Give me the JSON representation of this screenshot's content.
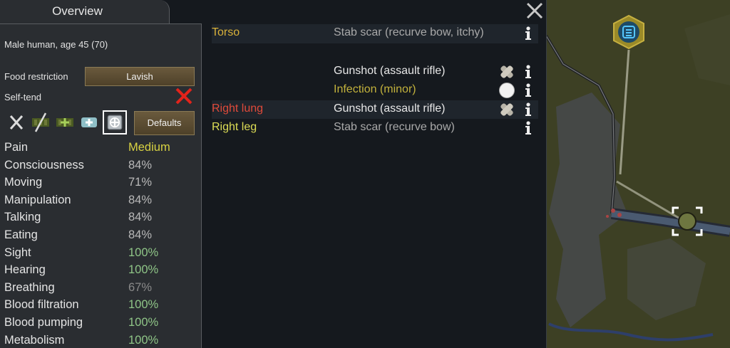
{
  "window": {
    "tab_label": "Overview",
    "close_icon": "close-icon"
  },
  "overview": {
    "pawn_description": "Male human, age 45 (70)",
    "food_restriction_label": "Food restriction",
    "food_restriction_value": "Lavish",
    "self_tend_label": "Self-tend",
    "self_tend_state": "off",
    "medical_care_options": [
      "no-care",
      "no-meds",
      "herbal",
      "industrial",
      "glitterworld"
    ],
    "medical_care_selected": "glitterworld",
    "defaults_label": "Defaults",
    "capacities": [
      {
        "name": "Pain",
        "value": "Medium",
        "color": "#d8d242"
      },
      {
        "name": "Consciousness",
        "value": "84%",
        "color": "#b9b9b9"
      },
      {
        "name": "Moving",
        "value": "71%",
        "color": "#b9b9b9"
      },
      {
        "name": "Manipulation",
        "value": "84%",
        "color": "#b9b9b9"
      },
      {
        "name": "Talking",
        "value": "84%",
        "color": "#b9b9b9"
      },
      {
        "name": "Eating",
        "value": "84%",
        "color": "#b9b9b9"
      },
      {
        "name": "Sight",
        "value": "100%",
        "color": "#8fc587"
      },
      {
        "name": "Hearing",
        "value": "100%",
        "color": "#8fc587"
      },
      {
        "name": "Breathing",
        "value": "67%",
        "color": "#8a8a8a"
      },
      {
        "name": "Blood filtration",
        "value": "100%",
        "color": "#8fc587"
      },
      {
        "name": "Blood pumping",
        "value": "100%",
        "color": "#8fc587"
      },
      {
        "name": "Metabolism",
        "value": "100%",
        "color": "#8fc587"
      }
    ]
  },
  "health": {
    "rows": [
      {
        "part": "Torso",
        "part_color": "#d9b13a",
        "shaded": true,
        "entries": [
          {
            "label": "Stab scar (recurve bow, itchy)",
            "color": "#a9a9a9",
            "icon": ""
          }
        ]
      },
      {
        "part": "",
        "part_color": "#d9b13a",
        "shaded": false,
        "entries": [
          {
            "label": "Gunshot (assault rifle)",
            "color": "#e8e8e8",
            "icon": "bandage-icon"
          },
          {
            "label": "Infection (minor)",
            "color": "#c3b23c",
            "icon": "infection-icon"
          }
        ]
      },
      {
        "part": "Right lung",
        "part_color": "#e04a3a",
        "shaded": true,
        "entries": [
          {
            "label": "Gunshot (assault rifle)",
            "color": "#e8e8e8",
            "icon": "bandage-icon"
          }
        ]
      },
      {
        "part": "Right leg",
        "part_color": "#dddd55",
        "shaded": false,
        "entries": [
          {
            "label": "Stab scar (recurve bow)",
            "color": "#a9a9a9",
            "icon": ""
          }
        ]
      }
    ]
  }
}
